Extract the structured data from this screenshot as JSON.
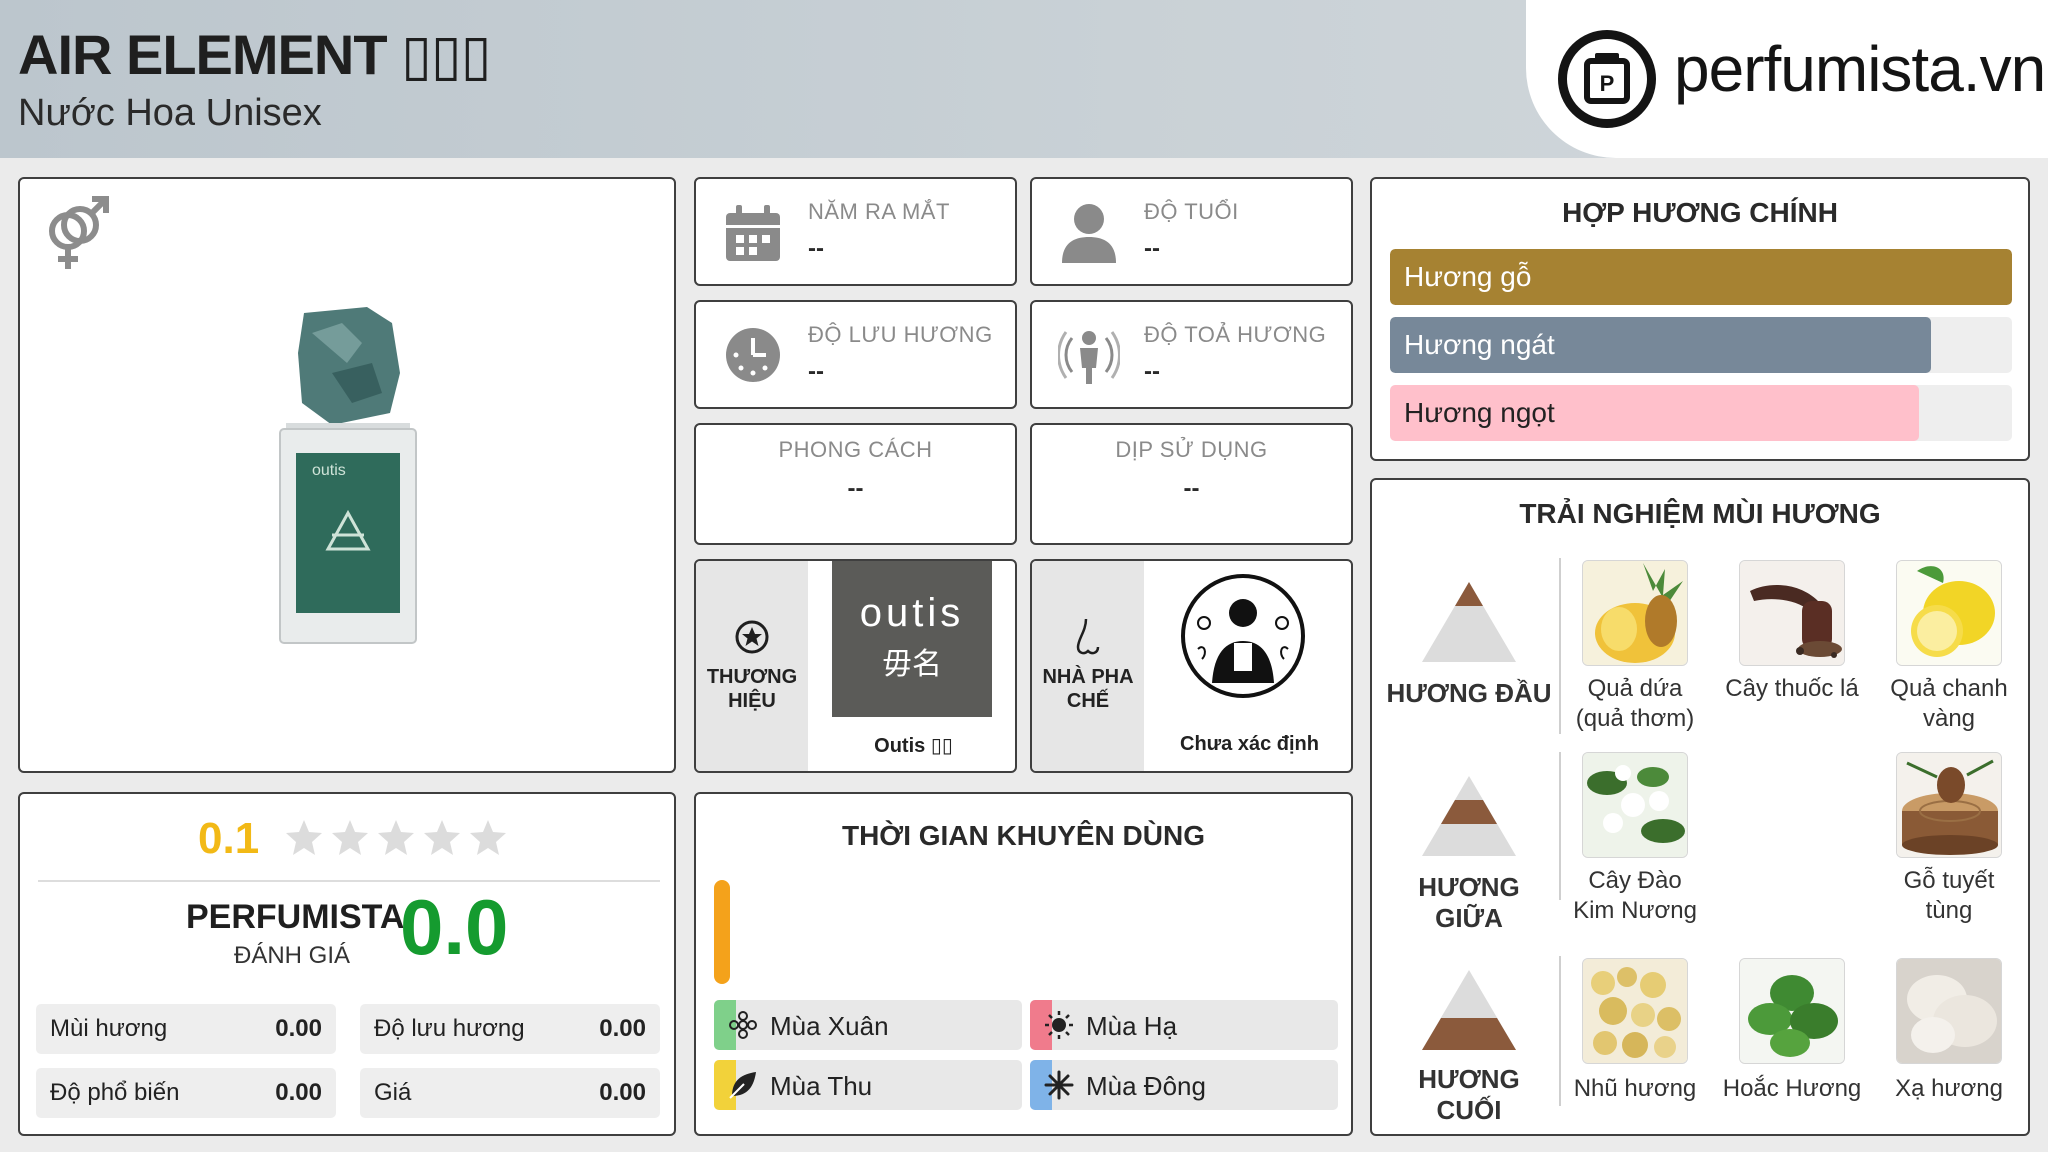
{
  "header": {
    "title": "AIR ELEMENT ▯▯▯",
    "subtitle": "Nước Hoa Unisex",
    "logo_text": "perfumista.vn"
  },
  "product": {
    "gender_icon": "unisex-icon",
    "image": "perfume-bottle"
  },
  "info": {
    "release_year": {
      "label": "NĂM RA MẮT",
      "value": "--",
      "icon": "calendar-icon"
    },
    "age": {
      "label": "ĐỘ TUỔI",
      "value": "--",
      "icon": "person-icon"
    },
    "longevity": {
      "label": "ĐỘ LƯU HƯƠNG",
      "value": "--",
      "icon": "clock-icon"
    },
    "sillage": {
      "label": "ĐỘ TOẢ HƯƠNG",
      "value": "--",
      "icon": "sillage-icon"
    },
    "style": {
      "label": "PHONG CÁCH",
      "value": "--"
    },
    "occasion": {
      "label": "DỊP SỬ DỤNG",
      "value": "--"
    }
  },
  "brand": {
    "label": "THƯƠNG\nHIỆU",
    "logo_line1": "outis",
    "logo_line2": "毋名",
    "name": "Outis ▯▯",
    "icon": "star-icon"
  },
  "perfumer": {
    "label": "NHÀ PHA\nCHẾ",
    "name": "Chưa xác định",
    "icon": "nose-icon"
  },
  "accords": {
    "title": "HỢP HƯƠNG CHÍNH",
    "items": [
      {
        "label": "Hương gỗ",
        "level": 1.0,
        "color": "#a68232"
      },
      {
        "label": "Hương ngát",
        "level": 0.87,
        "color": "#778899"
      },
      {
        "label": "Hương ngọt",
        "level": 0.85,
        "color": "#ffc0cb"
      }
    ]
  },
  "rating": {
    "user_score": "0.1",
    "stars": 5,
    "perfumista_label": "PERFUMISTA",
    "perfumista_sub": "ĐÁNH GIÁ",
    "perfumista_score": "0.0",
    "boxes": [
      {
        "label": "Mùi hương",
        "value": "0.00"
      },
      {
        "label": "Độ lưu hương",
        "value": "0.00"
      },
      {
        "label": "Độ phổ biến",
        "value": "0.00"
      },
      {
        "label": "Giá",
        "value": "0.00"
      }
    ]
  },
  "seasons": {
    "title": "THỜI GIAN KHUYÊN DÙNG",
    "day_color": "#f4a21b",
    "items": [
      {
        "label": "Mùa Xuân",
        "color": "#7fd08a",
        "icon": "spring-flower-icon"
      },
      {
        "label": "Mùa Hạ",
        "color": "#f07b8c",
        "icon": "sun-icon"
      },
      {
        "label": "Mùa Thu",
        "color": "#f2d23a",
        "icon": "leaf-icon"
      },
      {
        "label": "Mùa Đông",
        "color": "#7fb3e8",
        "icon": "snowflake-icon"
      }
    ]
  },
  "notes": {
    "title": "TRẢI NGHIỆM MÙI HƯƠNG",
    "top": {
      "label": "HƯƠNG ĐẦU",
      "items": [
        "Quả dứa\n(quả thơm)",
        "Cây thuốc lá",
        "Quả chanh\nvàng"
      ]
    },
    "middle": {
      "label": "HƯƠNG GIỮA",
      "items": [
        "Cây Đào\nKim Nương",
        "Gỗ tuyết\ntùng"
      ]
    },
    "base": {
      "label": "HƯƠNG CUỐI",
      "items": [
        "Nhũ hương",
        "Hoắc Hương",
        "Xạ hương"
      ]
    }
  }
}
